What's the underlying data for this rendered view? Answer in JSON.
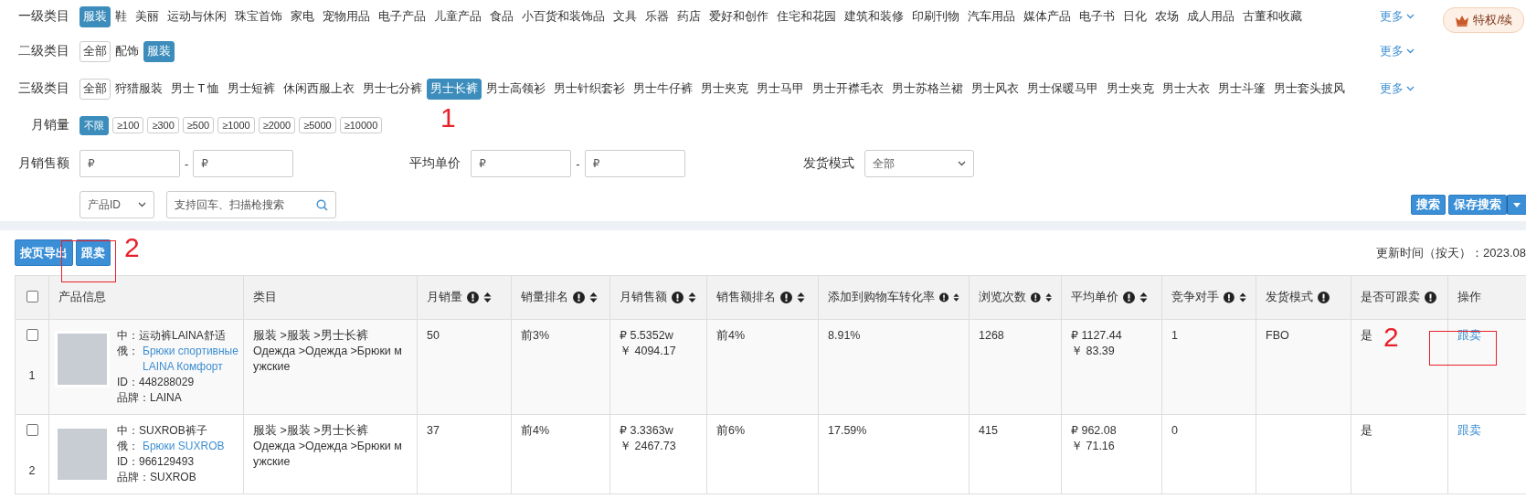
{
  "filters": {
    "category_rows": [
      {
        "label": "一级类目",
        "items": [
          {
            "label": "服装",
            "selected": true
          },
          {
            "label": "鞋",
            "selected": false
          },
          {
            "label": "美丽",
            "selected": false
          },
          {
            "label": "运动与休闲",
            "selected": false
          },
          {
            "label": "珠宝首饰",
            "selected": false
          },
          {
            "label": "家电",
            "selected": false
          },
          {
            "label": "宠物用品",
            "selected": false
          },
          {
            "label": "电子产品",
            "selected": false
          },
          {
            "label": "儿童产品",
            "selected": false
          },
          {
            "label": "食品",
            "selected": false
          },
          {
            "label": "小百货和装饰品",
            "selected": false
          },
          {
            "label": "文具",
            "selected": false
          },
          {
            "label": "乐器",
            "selected": false
          },
          {
            "label": "药店",
            "selected": false
          },
          {
            "label": "爱好和创作",
            "selected": false
          },
          {
            "label": "住宅和花园",
            "selected": false
          },
          {
            "label": "建筑和装修",
            "selected": false
          },
          {
            "label": "印刷刊物",
            "selected": false
          },
          {
            "label": "汽车用品",
            "selected": false
          },
          {
            "label": "媒体产品",
            "selected": false
          },
          {
            "label": "电子书",
            "selected": false
          },
          {
            "label": "日化",
            "selected": false
          },
          {
            "label": "农场",
            "selected": false
          },
          {
            "label": "成人用品",
            "selected": false
          },
          {
            "label": "古董和收藏",
            "selected": false
          }
        ],
        "more": "更多"
      },
      {
        "label": "二级类目",
        "items": [
          {
            "label": "全部",
            "selected": false,
            "kind": "all"
          },
          {
            "label": "配饰",
            "selected": false
          },
          {
            "label": "服装",
            "selected": true
          }
        ],
        "more": "更多"
      },
      {
        "label": "三级类目",
        "items": [
          {
            "label": "全部",
            "selected": false,
            "kind": "all"
          },
          {
            "label": "狩猎服装",
            "selected": false
          },
          {
            "label": "男士 T 恤",
            "selected": false
          },
          {
            "label": "男士短裤",
            "selected": false
          },
          {
            "label": "休闲西服上衣",
            "selected": false
          },
          {
            "label": "男士七分裤",
            "selected": false
          },
          {
            "label": "男士长裤",
            "selected": true
          },
          {
            "label": "男士高领衫",
            "selected": false
          },
          {
            "label": "男士针织套衫",
            "selected": false
          },
          {
            "label": "男士牛仔裤",
            "selected": false
          },
          {
            "label": "男士夹克",
            "selected": false
          },
          {
            "label": "男士马甲",
            "selected": false
          },
          {
            "label": "男士开襟毛衣",
            "selected": false
          },
          {
            "label": "男士苏格兰裙",
            "selected": false
          },
          {
            "label": "男士风衣",
            "selected": false
          },
          {
            "label": "男士保暖马甲",
            "selected": false
          },
          {
            "label": "男士夹克",
            "selected": false
          },
          {
            "label": "男士大衣",
            "selected": false
          },
          {
            "label": "男士斗篷",
            "selected": false
          },
          {
            "label": "男士套头披风",
            "selected": false
          }
        ],
        "more": "更多"
      }
    ],
    "sales_volume": {
      "label": "月销量",
      "options": [
        {
          "label": "不限",
          "selected": true
        },
        {
          "label": "≥100",
          "selected": false
        },
        {
          "label": "≥300",
          "selected": false
        },
        {
          "label": "≥500",
          "selected": false
        },
        {
          "label": "≥1000",
          "selected": false
        },
        {
          "label": "≥2000",
          "selected": false
        },
        {
          "label": "≥5000",
          "selected": false
        },
        {
          "label": "≥10000",
          "selected": false
        }
      ]
    },
    "ranges": [
      {
        "label": "月销售额",
        "min_placeholder": "₽",
        "separator": "-",
        "max_placeholder": "₽"
      },
      {
        "label": "平均单价",
        "min_placeholder": "₽",
        "separator": "-",
        "max_placeholder": "₽"
      }
    ],
    "shipping": {
      "label": "发货模式",
      "value": "全部"
    },
    "search_type": "产品ID",
    "search": {
      "placeholder": "支持回车、扫描枪搜索"
    },
    "search_button": "搜索",
    "save_button": "保存搜索"
  },
  "privilege_button": "特权/续",
  "toolbar": {
    "buttons": [
      "按页导出",
      "跟卖"
    ],
    "update_time": "更新时间（按天）：2023.08"
  },
  "table": {
    "header_checked": false,
    "columns": [
      {
        "label": "产品信息",
        "info": false,
        "sortable": false
      },
      {
        "label": "类目",
        "info": false,
        "sortable": false
      },
      {
        "label": "月销量",
        "info": true,
        "sortable": true
      },
      {
        "label": "销量排名",
        "info": true,
        "sortable": true
      },
      {
        "label": "月销售额",
        "info": true,
        "sortable": true
      },
      {
        "label": "销售额排名",
        "info": true,
        "sortable": true
      },
      {
        "label": "添加到购物车转化率",
        "info": true,
        "sortable": true
      },
      {
        "label": "浏览次数",
        "info": true,
        "sortable": true
      },
      {
        "label": "平均单价",
        "info": true,
        "sortable": true
      },
      {
        "label": "竞争对手",
        "info": true,
        "sortable": true
      },
      {
        "label": "发货模式",
        "info": true,
        "sortable": false
      },
      {
        "label": "是否可跟卖",
        "info": true,
        "sortable": false
      },
      {
        "label": "操作",
        "info": false,
        "sortable": false
      }
    ],
    "rows": [
      {
        "number": "1",
        "checked": false,
        "name_cn": "中：运动裤LAINA舒适",
        "ru_label": "俄：",
        "name_ru": "Брюки спортивные LAINA Комфорт",
        "id": "ID：448288029",
        "brand": "品牌：LAINA",
        "category_cn": "服装 >服装 >男士长裤",
        "category_ru": "Одежда >Одежда >Брюки мужские",
        "monthly_sales": "50",
        "sales_rank": "前3%",
        "revenue_rub": "₽ 5.5352w",
        "revenue_cny": "￥ 4094.17",
        "revenue_rank": "前4%",
        "cart_rate": "8.91%",
        "views": "1268",
        "price_rub": "₽ 1127.44",
        "price_cny": "￥ 83.39",
        "competitors": "1",
        "shipping": "FBO",
        "followable": "是",
        "action": "跟卖"
      },
      {
        "number": "2",
        "checked": false,
        "name_cn": "中：SUXROB裤子",
        "ru_label": "俄：",
        "name_ru": "Брюки SUXROB",
        "id": "ID：966129493",
        "brand": "品牌：SUXROB",
        "category_cn": "服装 >服装 >男士长裤",
        "category_ru": "Одежда >Одежда >Брюки мужские",
        "monthly_sales": "37",
        "sales_rank": "前4%",
        "revenue_rub": "₽ 3.3363w",
        "revenue_cny": "￥ 2467.73",
        "revenue_rank": "前6%",
        "cart_rate": "17.59%",
        "views": "415",
        "price_rub": "₽ 962.08",
        "price_cny": "￥ 71.16",
        "competitors": "0",
        "followable": "是",
        "action": "跟卖"
      }
    ]
  },
  "annotations": [
    {
      "text": "1"
    },
    {
      "text": "2"
    },
    {
      "text": "2"
    }
  ]
}
